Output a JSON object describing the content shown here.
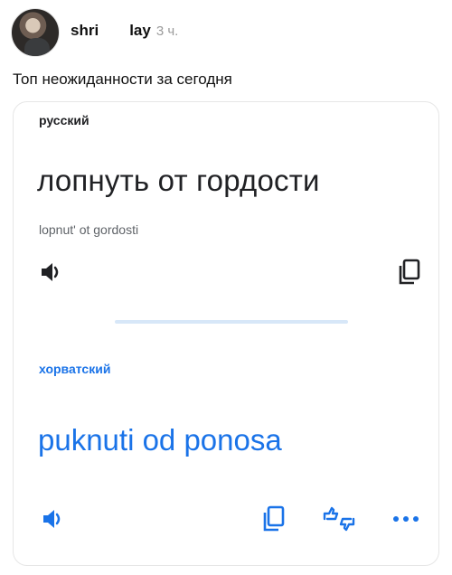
{
  "post": {
    "author": "shri",
    "author_suffix": "lay",
    "time": "3 ч.",
    "text": "Топ неожиданности за сегодня"
  },
  "translation": {
    "source_language": "русский",
    "source_text": "лопнуть от гордости",
    "transliteration": "lopnut' ot gordosti",
    "target_language": "хорватский",
    "target_text": "puknuti od ponosa"
  },
  "icons": {
    "source_speaker": "speaker-icon",
    "source_copy": "copy-icon",
    "target_speaker": "speaker-icon",
    "target_copy": "copy-icon",
    "rate": "thumbs-rate-icon",
    "more": "more-dots-icon"
  },
  "colors": {
    "accent_blue": "#1a73e8",
    "source_text": "#202124",
    "divider": "#d7e7f8"
  }
}
